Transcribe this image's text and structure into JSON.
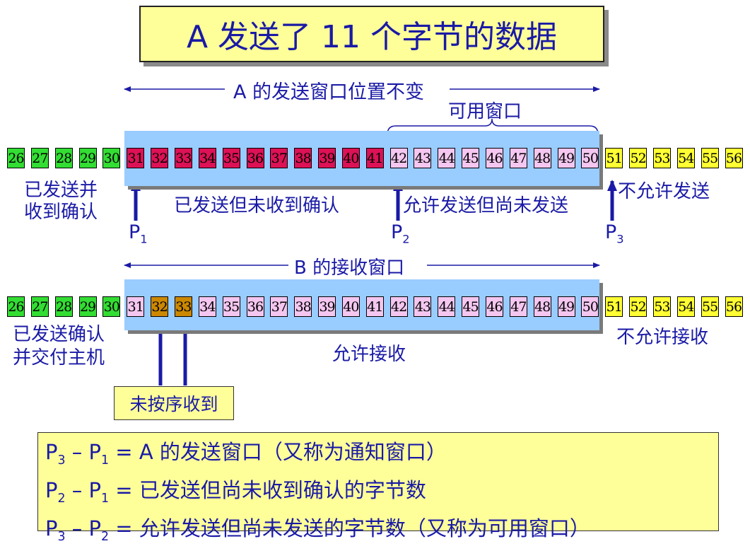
{
  "title": "A 发送了 11 个字节的数据",
  "colors": {
    "acked": "#33dd33",
    "sent_unacked": "#dd1155",
    "allowed": "#f4c6f0",
    "not_allowed": "#ffff33",
    "received_out_of_order": "#cc8800",
    "window": "#99ccff",
    "text": "#1a1aa6"
  },
  "sender": {
    "window_label": "A 的发送窗口位置不变",
    "usable_label": "可用窗口",
    "acked_label_line1": "已发送并",
    "acked_label_line2": "收到确认",
    "sent_unacked_label": "已发送但未收到确认",
    "allowed_label": "允许发送但尚未发送",
    "not_allowed_label": "不允许发送",
    "p1_main": "P",
    "p1_sub": "1",
    "p2_main": "P",
    "p2_sub": "2",
    "p3_main": "P",
    "p3_sub": "3",
    "bytes": [
      {
        "n": "26",
        "state": "acked"
      },
      {
        "n": "27",
        "state": "acked"
      },
      {
        "n": "28",
        "state": "acked"
      },
      {
        "n": "29",
        "state": "acked"
      },
      {
        "n": "30",
        "state": "acked"
      },
      {
        "n": "31",
        "state": "sent_unacked"
      },
      {
        "n": "32",
        "state": "sent_unacked"
      },
      {
        "n": "33",
        "state": "sent_unacked"
      },
      {
        "n": "34",
        "state": "sent_unacked"
      },
      {
        "n": "35",
        "state": "sent_unacked"
      },
      {
        "n": "36",
        "state": "sent_unacked"
      },
      {
        "n": "37",
        "state": "sent_unacked"
      },
      {
        "n": "38",
        "state": "sent_unacked"
      },
      {
        "n": "39",
        "state": "sent_unacked"
      },
      {
        "n": "40",
        "state": "sent_unacked"
      },
      {
        "n": "41",
        "state": "sent_unacked"
      },
      {
        "n": "42",
        "state": "allowed"
      },
      {
        "n": "43",
        "state": "allowed"
      },
      {
        "n": "44",
        "state": "allowed"
      },
      {
        "n": "45",
        "state": "allowed"
      },
      {
        "n": "46",
        "state": "allowed"
      },
      {
        "n": "47",
        "state": "allowed"
      },
      {
        "n": "48",
        "state": "allowed"
      },
      {
        "n": "49",
        "state": "allowed"
      },
      {
        "n": "50",
        "state": "allowed"
      },
      {
        "n": "51",
        "state": "not_allowed"
      },
      {
        "n": "52",
        "state": "not_allowed"
      },
      {
        "n": "53",
        "state": "not_allowed"
      },
      {
        "n": "54",
        "state": "not_allowed"
      },
      {
        "n": "55",
        "state": "not_allowed"
      },
      {
        "n": "56",
        "state": "not_allowed"
      }
    ]
  },
  "receiver": {
    "window_label": "B 的接收窗口",
    "delivered_label_line1": "已发送确认",
    "delivered_label_line2": "并交付主机",
    "allowed_label": "允许接收",
    "not_allowed_label": "不允许接收",
    "out_of_order_label": "未按序收到",
    "bytes": [
      {
        "n": "26",
        "state": "acked"
      },
      {
        "n": "27",
        "state": "acked"
      },
      {
        "n": "28",
        "state": "acked"
      },
      {
        "n": "29",
        "state": "acked"
      },
      {
        "n": "30",
        "state": "acked"
      },
      {
        "n": "31",
        "state": "allowed"
      },
      {
        "n": "32",
        "state": "received_out_of_order"
      },
      {
        "n": "33",
        "state": "received_out_of_order"
      },
      {
        "n": "34",
        "state": "allowed"
      },
      {
        "n": "35",
        "state": "allowed"
      },
      {
        "n": "36",
        "state": "allowed"
      },
      {
        "n": "37",
        "state": "allowed"
      },
      {
        "n": "38",
        "state": "allowed"
      },
      {
        "n": "39",
        "state": "allowed"
      },
      {
        "n": "40",
        "state": "allowed"
      },
      {
        "n": "41",
        "state": "allowed"
      },
      {
        "n": "42",
        "state": "allowed"
      },
      {
        "n": "43",
        "state": "allowed"
      },
      {
        "n": "44",
        "state": "allowed"
      },
      {
        "n": "45",
        "state": "allowed"
      },
      {
        "n": "46",
        "state": "allowed"
      },
      {
        "n": "47",
        "state": "allowed"
      },
      {
        "n": "48",
        "state": "allowed"
      },
      {
        "n": "49",
        "state": "allowed"
      },
      {
        "n": "50",
        "state": "allowed"
      },
      {
        "n": "51",
        "state": "not_allowed"
      },
      {
        "n": "52",
        "state": "not_allowed"
      },
      {
        "n": "53",
        "state": "not_allowed"
      },
      {
        "n": "54",
        "state": "not_allowed"
      },
      {
        "n": "55",
        "state": "not_allowed"
      },
      {
        "n": "56",
        "state": "not_allowed"
      }
    ]
  },
  "summary": [
    {
      "lhs_a": "P",
      "lhs_a_sub": "3",
      "dash": " – ",
      "lhs_b": "P",
      "lhs_b_sub": "1",
      "rhs": " = A 的发送窗口（又称为通知窗口）"
    },
    {
      "lhs_a": "P",
      "lhs_a_sub": "2",
      "dash": " – ",
      "lhs_b": "P",
      "lhs_b_sub": "1",
      "rhs": " = 已发送但尚未收到确认的字节数"
    },
    {
      "lhs_a": "P",
      "lhs_a_sub": "3",
      "dash": " – ",
      "lhs_b": "P",
      "lhs_b_sub": "2",
      "rhs": " = 允许发送但尚未发送的字节数（又称为可用窗口）"
    }
  ]
}
